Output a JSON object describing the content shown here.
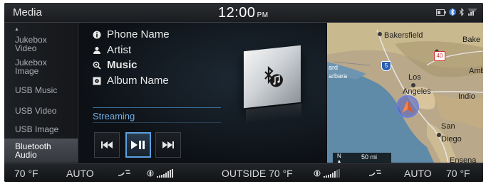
{
  "header": {
    "app_title": "Media",
    "clock": "12:00",
    "ampm": "PM"
  },
  "sidebar": {
    "items": [
      {
        "label": "Jukebox\nVideo"
      },
      {
        "label": "Jukebox\nImage"
      },
      {
        "label": "USB Music"
      },
      {
        "label": "USB Video"
      },
      {
        "label": "USB Image"
      },
      {
        "label": "Bluetooth\nAudio"
      }
    ],
    "active_index": 5
  },
  "media": {
    "phone_name": "Phone Name",
    "artist": "Artist",
    "music": "Music",
    "album": "Album Name",
    "source": "Streaming",
    "controls": [
      "previous",
      "play-pause",
      "next"
    ]
  },
  "map": {
    "labels": [
      "Bakersfield",
      "Bake",
      "Los",
      "Angeles",
      "Indio",
      "San",
      "Diego",
      "Ensena",
      "Ambo",
      "arbara",
      "ard"
    ],
    "highway_shields": [
      "40",
      "5"
    ],
    "scale_text": "50 mi",
    "north": "N"
  },
  "climate": {
    "left_temp": "70 °F",
    "left_mode": "AUTO",
    "outside": "OUTSIDE 70 °F",
    "right_mode": "AUTO",
    "right_temp": "70 °F"
  },
  "colors": {
    "accent_blue": "#5da0e0",
    "streaming_text": "#6fb0e8",
    "nav_arrow": "#e0592a"
  }
}
